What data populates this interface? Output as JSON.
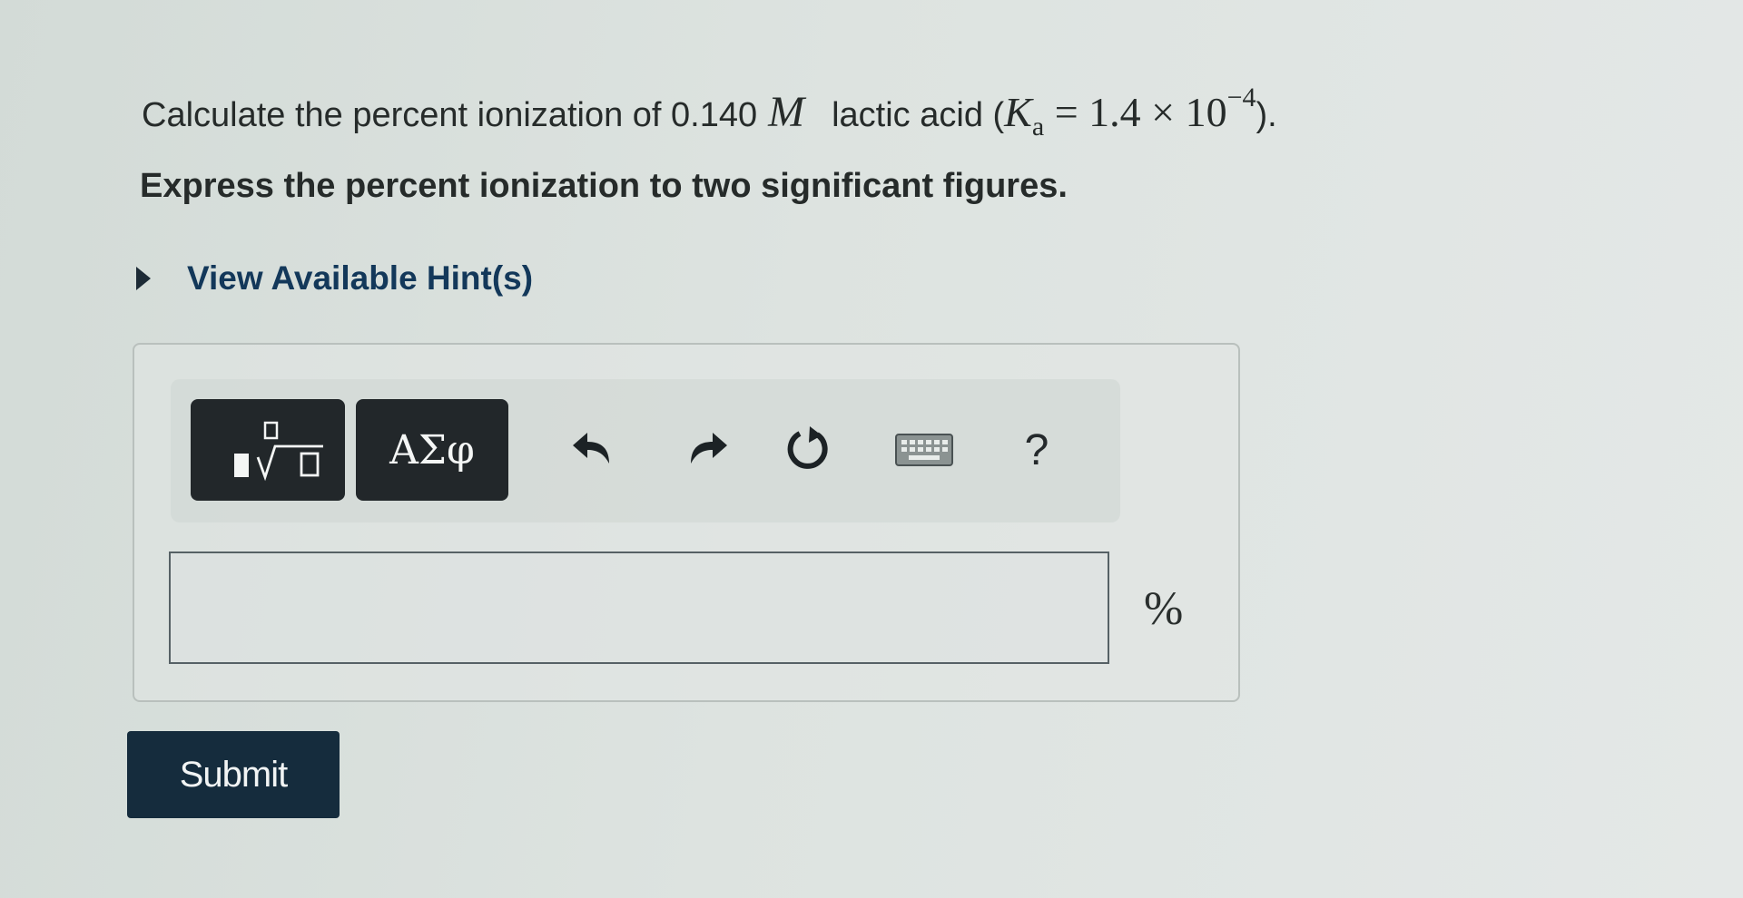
{
  "question": {
    "prefix": "Calculate the percent ionization of 0.140",
    "molarity_unit": "M",
    "acid": "lactic acid (",
    "ka_symbol": "K",
    "ka_subscript": "a",
    "ka_value": " = 1.4 × 10",
    "ka_exponent": "−4",
    "suffix": ")."
  },
  "instruction": "Express the percent ionization to two significant figures.",
  "hint": {
    "label": "View Available Hint(s)",
    "icon": "triangle-right-icon"
  },
  "toolbar": {
    "template_icon": "math-templates-icon",
    "greek_label": "ΑΣφ",
    "undo_icon": "undo-icon",
    "redo_icon": "redo-icon",
    "reset_icon": "reset-icon",
    "keyboard_icon": "keyboard-icon",
    "help_label": "?"
  },
  "answer": {
    "value": "",
    "unit": "%"
  },
  "submit_label": "Submit",
  "colors": {
    "submit_bg": "#152c3d",
    "toolbar_btn_bg": "#22272a",
    "hint_text": "#13385a"
  }
}
